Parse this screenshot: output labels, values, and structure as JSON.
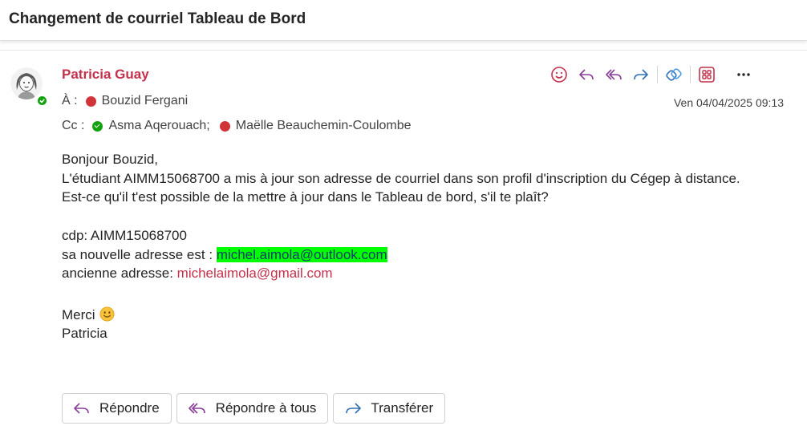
{
  "subject": "Changement de courriel Tableau de Bord",
  "sender": {
    "name": "Patricia Guay",
    "presence": "available"
  },
  "recipients": {
    "to_label": "À :",
    "to": [
      {
        "name": "Bouzid Fergani",
        "presence": "busy"
      }
    ],
    "cc_label": "Cc :",
    "cc": [
      {
        "name": "Asma Aqerouach;",
        "presence": "available"
      },
      {
        "name": "Maëlle Beauchemin-Coulombe",
        "presence": "busy"
      }
    ]
  },
  "date": "Ven 04/04/2025 09:13",
  "toolbar": {
    "icons": [
      "emoji-icon",
      "reply-icon",
      "reply-all-icon",
      "forward-icon",
      "viva-insights-icon",
      "apps-icon",
      "more-icon"
    ]
  },
  "body": {
    "greeting": "Bonjour Bouzid,",
    "line1": "L'étudiant AIMM15068700 a mis à jour son adresse de courriel dans son profil d'inscription du Cégep à distance.",
    "line2": "Est-ce qu'il t'est possible de la mettre à jour dans le Tableau de bord, s'il te plaît?",
    "cdp": "cdp: AIMM15068700",
    "new_prefix": "sa nouvelle adresse est : ",
    "new_email": "michel.aimola@outlook.com",
    "old_prefix": "ancienne adresse: ",
    "old_email": "michelaimola@gmail.com",
    "thanks": "Merci",
    "signature": "Patricia"
  },
  "actions": {
    "reply": "Répondre",
    "reply_all": "Répondre à tous",
    "forward": "Transférer"
  },
  "colors": {
    "sender": "#c4314b",
    "accent_purple": "#8a3d99",
    "accent_blue": "#2f6fb5",
    "highlight": "#00ff00"
  }
}
